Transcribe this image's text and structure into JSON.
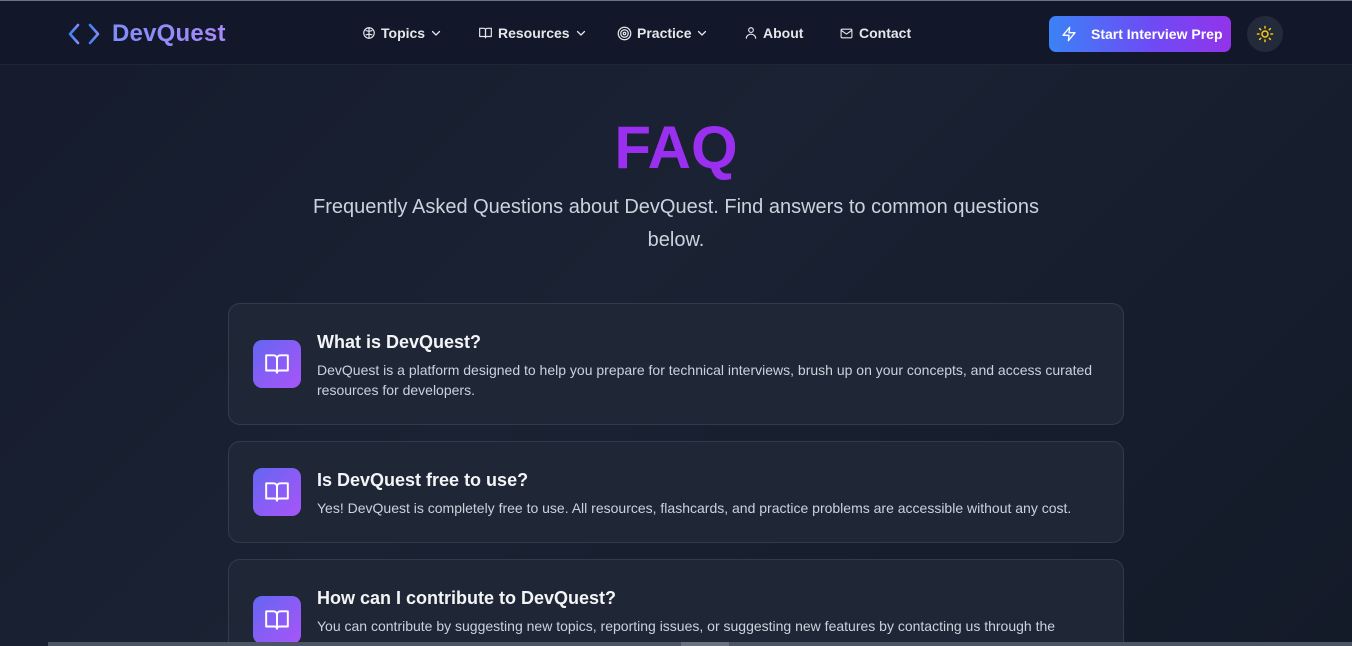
{
  "brand": {
    "name": "DevQuest",
    "icon": "code-brackets-icon"
  },
  "nav": {
    "items": [
      {
        "label": "Topics",
        "icon": "brain-icon",
        "dropdown": true
      },
      {
        "label": "Resources",
        "icon": "book-open-icon",
        "dropdown": true
      },
      {
        "label": "Practice",
        "icon": "target-icon",
        "dropdown": true
      },
      {
        "label": "About",
        "icon": "user-icon",
        "dropdown": false
      },
      {
        "label": "Contact",
        "icon": "mail-icon",
        "dropdown": false
      }
    ],
    "cta_label": "Start Interview Prep",
    "cta_icon": "lightning-icon",
    "theme_icon": "sun-icon"
  },
  "hero": {
    "title": "FAQ",
    "subtitle": "Frequently Asked Questions about DevQuest. Find answers to common questions below."
  },
  "faq": [
    {
      "icon": "book-open-icon",
      "question": "What is DevQuest?",
      "answer": "DevQuest is a platform designed to help you prepare for technical interviews, brush up on your concepts, and access curated resources for developers."
    },
    {
      "icon": "book-open-icon",
      "question": "Is DevQuest free to use?",
      "answer": "Yes! DevQuest is completely free to use. All resources, flashcards, and practice problems are accessible without any cost."
    },
    {
      "icon": "book-open-icon",
      "question": "How can I contribute to DevQuest?",
      "answer": "You can contribute by suggesting new topics, reporting issues, or suggesting new features by contacting us through the"
    }
  ],
  "colors": {
    "accent": "#9b2ff0",
    "brand_gradient_start": "#3b82f6",
    "brand_gradient_end": "#9333ea",
    "background": "#1a2233",
    "card": "#1f2737"
  }
}
